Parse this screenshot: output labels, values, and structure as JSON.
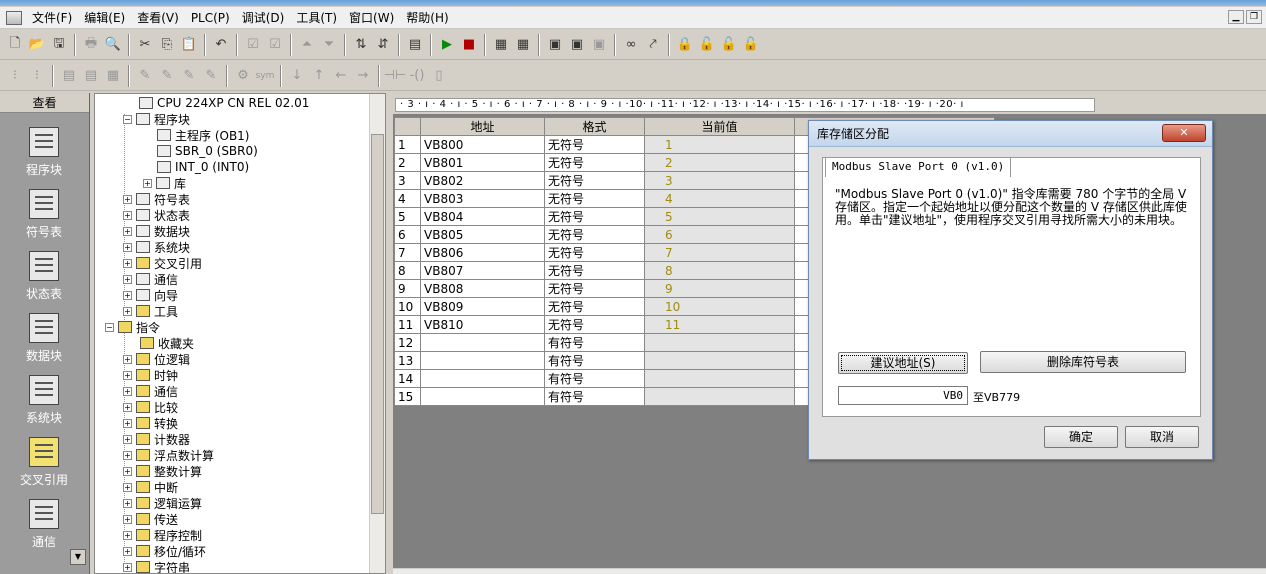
{
  "menu": [
    "文件(F)",
    "编辑(E)",
    "查看(V)",
    "PLC(P)",
    "调试(D)",
    "工具(T)",
    "窗口(W)",
    "帮助(H)"
  ],
  "navbar": {
    "header": "查看",
    "items": [
      "程序块",
      "符号表",
      "状态表",
      "数据块",
      "系统块",
      "交叉引用",
      "通信"
    ]
  },
  "tree": {
    "cpu": "CPU 224XP CN REL 02.01",
    "program_block": "程序块",
    "main": "主程序 (OB1)",
    "sbr": "SBR_0 (SBR0)",
    "int": "INT_0 (INT0)",
    "library": "库",
    "symbol_table": "符号表",
    "status_table": "状态表",
    "data_block": "数据块",
    "system_block": "系统块",
    "cross_ref": "交叉引用",
    "comm": "通信",
    "wizard": "向导",
    "tools": "工具",
    "instructions": "指令",
    "favorites": "收藏夹",
    "bit_logic": "位逻辑",
    "clock": "时钟",
    "comm2": "通信",
    "compare": "比较",
    "convert": "转换",
    "counter": "计数器",
    "float_math": "浮点数计算",
    "int_math": "整数计算",
    "interrupt": "中断",
    "logic_ops": "逻辑运算",
    "transfer": "传送",
    "program_control": "程序控制",
    "shift_rotate": "移位/循环",
    "string": "字符串"
  },
  "ruler": "· 3 · ı · 4 · ı · 5 · ı · 6 · ı · 7 · ı · 8 · ı · 9 · ı ·10· ı ·11· ı ·12· ı ·13· ı ·14· ı ·15· ı ·16· ı ·17· ı ·18·    ·19· ı ·20· ı",
  "status_table": {
    "headers": [
      "地址",
      "格式",
      "当前值"
    ],
    "rows": [
      {
        "n": "1",
        "addr": "VB800",
        "fmt": "无符号",
        "val": "1"
      },
      {
        "n": "2",
        "addr": "VB801",
        "fmt": "无符号",
        "val": "2"
      },
      {
        "n": "3",
        "addr": "VB802",
        "fmt": "无符号",
        "val": "3"
      },
      {
        "n": "4",
        "addr": "VB803",
        "fmt": "无符号",
        "val": "4"
      },
      {
        "n": "5",
        "addr": "VB804",
        "fmt": "无符号",
        "val": "5"
      },
      {
        "n": "6",
        "addr": "VB805",
        "fmt": "无符号",
        "val": "6"
      },
      {
        "n": "7",
        "addr": "VB806",
        "fmt": "无符号",
        "val": "7"
      },
      {
        "n": "8",
        "addr": "VB807",
        "fmt": "无符号",
        "val": "8"
      },
      {
        "n": "9",
        "addr": "VB808",
        "fmt": "无符号",
        "val": "9"
      },
      {
        "n": "10",
        "addr": "VB809",
        "fmt": "无符号",
        "val": "10"
      },
      {
        "n": "11",
        "addr": "VB810",
        "fmt": "无符号",
        "val": "11"
      },
      {
        "n": "12",
        "addr": "",
        "fmt": "有符号",
        "val": ""
      },
      {
        "n": "13",
        "addr": "",
        "fmt": "有符号",
        "val": ""
      },
      {
        "n": "14",
        "addr": "",
        "fmt": "有符号",
        "val": ""
      },
      {
        "n": "15",
        "addr": "",
        "fmt": "有符号",
        "val": ""
      }
    ]
  },
  "dialog": {
    "title": "库存储区分配",
    "tab": "Modbus Slave Port 0 (v1.0)",
    "text": "\"Modbus Slave Port 0 (v1.0)\" 指令库需要 780 个字节的全局 V 存储区。指定一个起始地址以便分配这个数量的 V 存储区供此库使用。单击\"建议地址\"，使用程序交叉引用寻找所需大小的未用块。",
    "suggest_btn": "建议地址(S)",
    "delete_btn": "删除库符号表",
    "address_value": "VB0",
    "address_to": "至VB779",
    "ok_btn": "确定",
    "cancel_btn": "取消"
  }
}
